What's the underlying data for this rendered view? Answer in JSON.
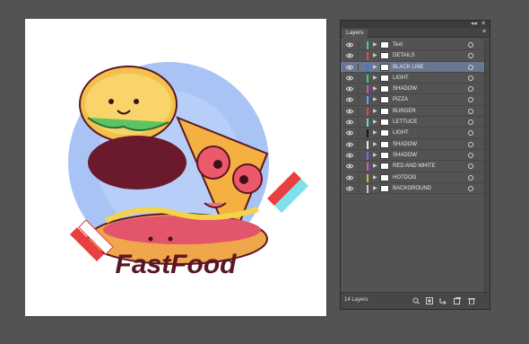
{
  "panel": {
    "tab_label": "Layers",
    "collapse_glyph": "◂◂",
    "close_glyph": "✕",
    "menu_glyph": "≡",
    "layer_count": "14 Layers"
  },
  "artwork": {
    "title_text": "FastFood"
  },
  "layers": [
    {
      "name": "Text",
      "color": "#4cd463",
      "thumb": "text-thumbnail",
      "selected": false
    },
    {
      "name": "DETAILS",
      "color": "#e5484d",
      "thumb": "details-thumbnail",
      "selected": false
    },
    {
      "name": "BLACK LINE",
      "color": "#2f7bf6",
      "thumb": "black-line-thumbnail",
      "selected": true
    },
    {
      "name": "LIGHT",
      "color": "#3fcf6d",
      "thumb": "light-thumbnail",
      "selected": false
    },
    {
      "name": "SHADOW",
      "color": "#d649d6",
      "thumb": "shadow-thumbnail",
      "selected": false
    },
    {
      "name": "PIZZA",
      "color": "#4fa7ff",
      "thumb": "pizza-thumbnail",
      "selected": false
    },
    {
      "name": "BURGER",
      "color": "#e54848",
      "thumb": "burger-thumbnail",
      "selected": false
    },
    {
      "name": "LETTUCE",
      "color": "#5de0e0",
      "thumb": "lettuce-thumbnail",
      "selected": false
    },
    {
      "name": "LIGHT",
      "color": "#161616",
      "thumb": "light-thumbnail",
      "selected": false
    },
    {
      "name": "SHADOW",
      "color": "#e8e8e8",
      "thumb": "shadow-thumbnail",
      "selected": false
    },
    {
      "name": "SHADOW",
      "color": "#9b59f0",
      "thumb": "shadow-thumbnail",
      "selected": false
    },
    {
      "name": "RED AND WHITE",
      "color": "#e04fe0",
      "thumb": "red-and-white-thumbnail",
      "selected": false
    },
    {
      "name": "HOTDOG",
      "color": "#e0b23a",
      "thumb": "hotdog-thumbnail",
      "selected": false
    },
    {
      "name": "BACKGROUND",
      "color": "#c9c9c9",
      "thumb": "background-thumbnail",
      "selected": false
    }
  ],
  "footer_icons": [
    {
      "name": "locate-object-icon"
    },
    {
      "name": "make-clipping-mask-icon"
    },
    {
      "name": "create-sublayer-icon"
    },
    {
      "name": "create-new-layer-icon"
    },
    {
      "name": "delete-layer-icon"
    }
  ]
}
